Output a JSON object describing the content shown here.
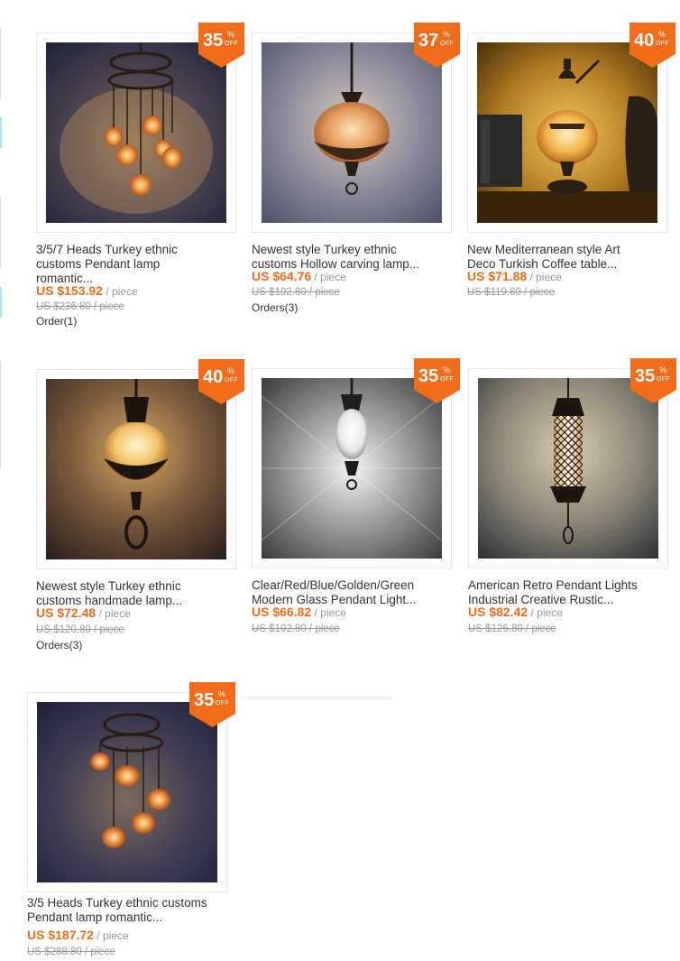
{
  "colors": {
    "accent": "#f26c1b",
    "muted": "#999999",
    "text": "#333333"
  },
  "badge": {
    "percent_sign": "%",
    "off_label": "OFF"
  },
  "products": [
    {
      "title_line1": "3/5/7 Heads Turkey ethnic",
      "title_line2": "customs Pendant lamp",
      "title_line3": "romantic...",
      "price": "US $153.92",
      "unit": " / piece",
      "old_price": "US $236.80 / piece",
      "orders": "Order(1)",
      "discount": "35",
      "image_icon": "multi-head-pendant-lamp"
    },
    {
      "title_line1": "Newest style Turkey ethnic",
      "title_line2": "customs Hollow carving lamp...",
      "title_line3": "",
      "price": "US $64.76",
      "unit": " / piece",
      "old_price": "US $102.80 / piece",
      "orders": "Orders(3)",
      "discount": "37",
      "image_icon": "single-pendant-lamp"
    },
    {
      "title_line1": "New Mediterranean style Art",
      "title_line2": "Deco Turkish Coffee table...",
      "title_line3": "",
      "price": "US $71.88",
      "unit": " / piece",
      "old_price": "US $119.80 / piece",
      "orders": "",
      "discount": "40",
      "image_icon": "table-lamp"
    },
    {
      "title_line1": "Newest style Turkey ethnic",
      "title_line2": "customs handmade lamp...",
      "title_line3": "",
      "price": "US $72.48",
      "unit": " / piece",
      "old_price": "US $120.80 / piece",
      "orders": "Orders(3)",
      "discount": "40",
      "image_icon": "single-pendant-lamp"
    },
    {
      "title_line1": "Clear/Red/Blue/Golden/Green",
      "title_line2": "Modern Glass Pendant Light...",
      "title_line3": "",
      "price": "US $66.82",
      "unit": " / piece",
      "old_price": "US $102.80 / piece",
      "orders": "",
      "discount": "35",
      "image_icon": "glass-pendant-lamp"
    },
    {
      "title_line1": "American Retro Pendant Lights",
      "title_line2": "Industrial Creative Rustic...",
      "title_line3": "",
      "price": "US $82.42",
      "unit": " / piece",
      "old_price": "US $126.80 / piece",
      "orders": "",
      "discount": "35",
      "image_icon": "cylinder-pendant-lamp"
    },
    {
      "title_line1": "3/5 Heads Turkey ethnic customs",
      "title_line2": "Pendant lamp romantic...",
      "title_line3": "",
      "price": "US $187.72",
      "unit": " / piece",
      "old_price": "US $288.80 / piece",
      "orders": "",
      "discount": "35",
      "image_icon": "multi-head-pendant-lamp"
    }
  ]
}
